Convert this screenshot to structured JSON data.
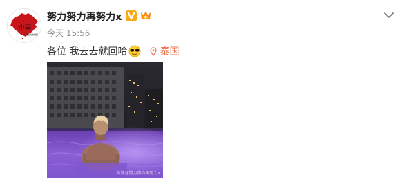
{
  "post": {
    "username": "努力努力再努力x",
    "time": "今天 15:56",
    "text": "各位 我去去就回哈",
    "emoji": "sunglasses-emoji",
    "location": "泰国",
    "photo_watermark": "微博@努力努力再努力x",
    "avatar_text": "中国",
    "avatar_subtext": "我爱我的祖国"
  },
  "icons": {
    "verified_badge": "v-badge-icon",
    "member_badge": "vip-member-icon",
    "location": "location-pin-icon",
    "menu": "chevron-down-icon"
  },
  "colors": {
    "username": "#222222",
    "meta": "#939393",
    "location": "#eb7350",
    "verified": "#f7ab1c",
    "avatar_map": "#c8161d"
  }
}
